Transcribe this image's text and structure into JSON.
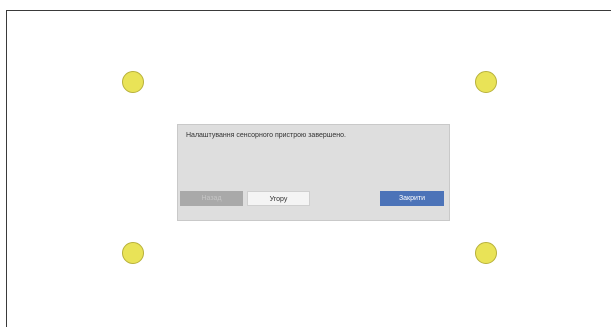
{
  "dialog": {
    "message": "Налаштування сенсорного пристрою завершено.",
    "buttons": {
      "back": "Назад",
      "cancel": "Угору",
      "close": "Закрити"
    }
  },
  "colors": {
    "target_fill": "#e9e357",
    "dialog_bg": "#dedede",
    "close_button": "#4c73b8",
    "disabled_button": "#a9a9a9"
  },
  "icons": {
    "calibration_targets": [
      "calibration-target-icon",
      "calibration-target-icon",
      "calibration-target-icon",
      "calibration-target-icon"
    ]
  }
}
